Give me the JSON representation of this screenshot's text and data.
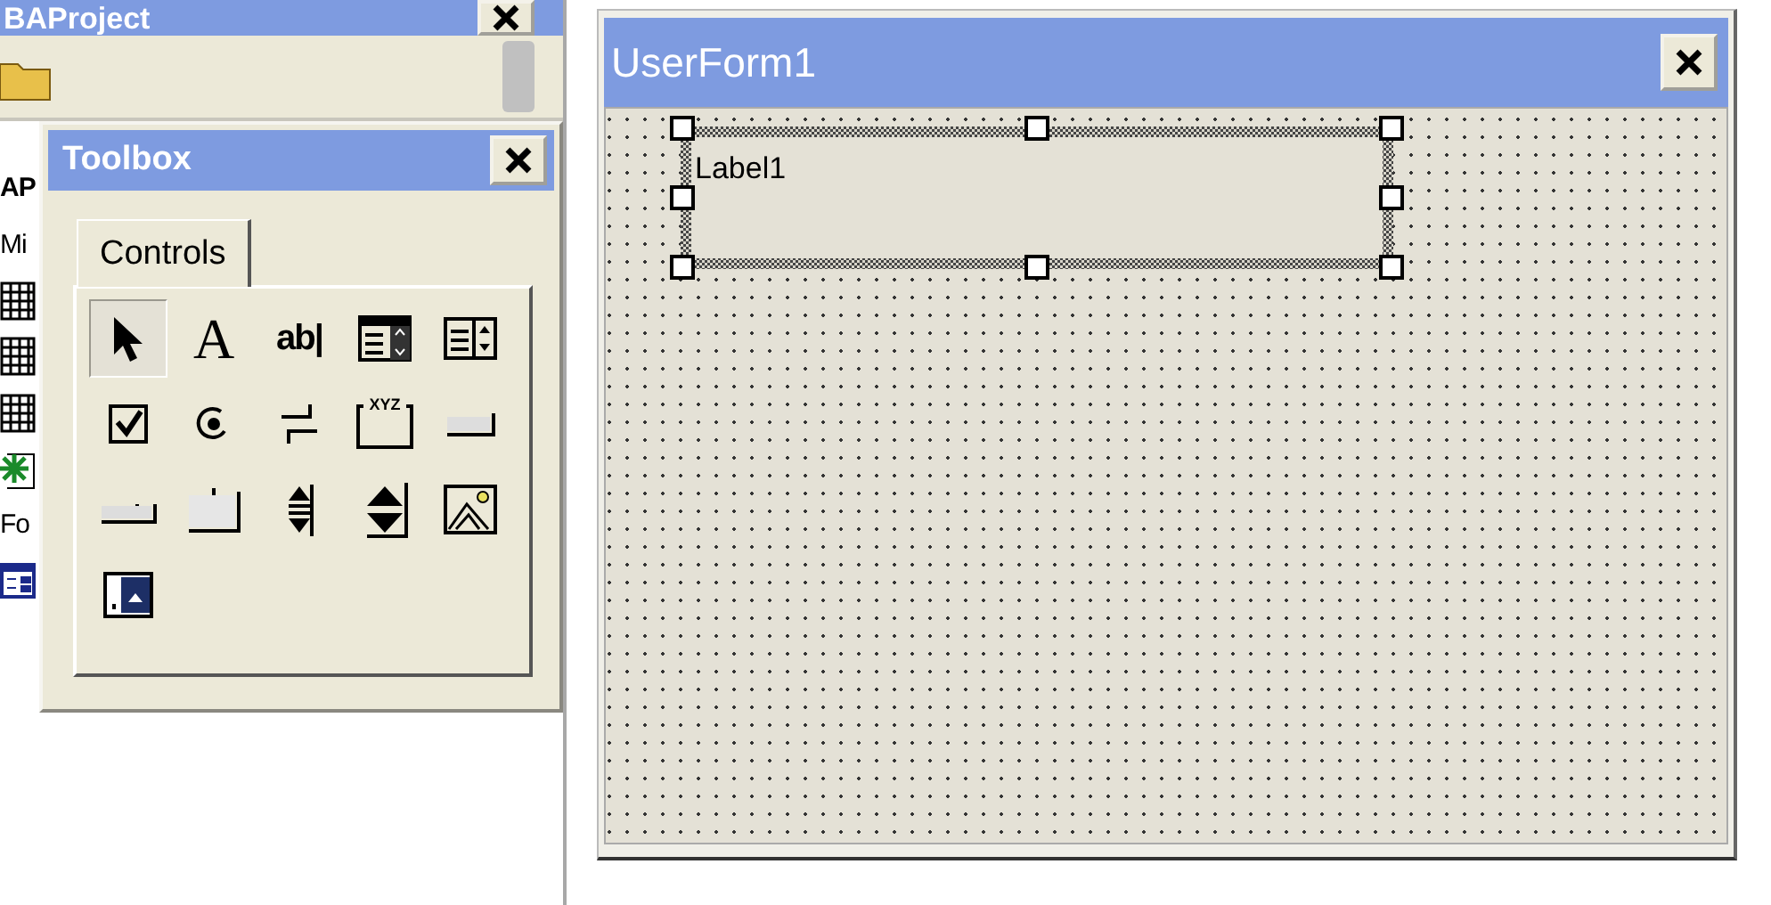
{
  "project_window": {
    "title": "BAProject",
    "tree": [
      {
        "kind": "text",
        "text": "AP",
        "bold": true
      },
      {
        "kind": "text",
        "text": "Mi",
        "bold": false
      },
      {
        "kind": "sheet"
      },
      {
        "kind": "sheet"
      },
      {
        "kind": "sheet"
      },
      {
        "kind": "workbook"
      },
      {
        "kind": "text",
        "text": "Fo",
        "bold": false
      },
      {
        "kind": "form"
      }
    ]
  },
  "toolbox": {
    "title": "Toolbox",
    "tabs": [
      {
        "label": "Controls",
        "selected": true
      }
    ],
    "tools": [
      {
        "kind": "pointer",
        "selected": true
      },
      {
        "kind": "label",
        "glyph": "A",
        "selected": false
      },
      {
        "kind": "textbox",
        "glyph": "ab|",
        "selected": false
      },
      {
        "kind": "combobox",
        "selected": false
      },
      {
        "kind": "listbox",
        "selected": false
      },
      {
        "kind": "checkbox",
        "selected": false
      },
      {
        "kind": "option",
        "selected": false
      },
      {
        "kind": "toggle",
        "selected": false
      },
      {
        "kind": "frame",
        "glyph": "XYZ",
        "selected": false
      },
      {
        "kind": "command",
        "selected": false
      },
      {
        "kind": "tabstrip",
        "selected": false
      },
      {
        "kind": "multipage",
        "selected": false
      },
      {
        "kind": "scrollbar",
        "selected": false
      },
      {
        "kind": "spin",
        "selected": false
      },
      {
        "kind": "image",
        "selected": false
      },
      {
        "kind": "refedit",
        "selected": false
      }
    ]
  },
  "userform": {
    "title": "UserForm1",
    "controls": [
      {
        "kind": "label",
        "text": "Label1",
        "selected": true
      }
    ]
  }
}
